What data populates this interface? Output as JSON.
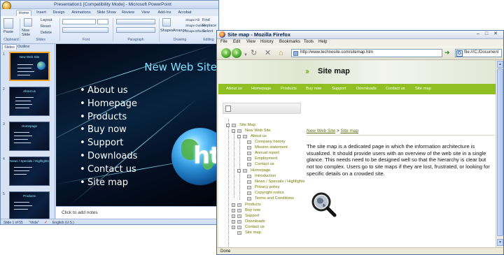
{
  "powerpoint": {
    "title": "Presentation1 [Compatibility Mode] - Microsoft PowerPoint",
    "tabs": [
      "Home",
      "Insert",
      "Design",
      "Animations",
      "Slide Show",
      "Review",
      "View",
      "Add-Ins",
      "Acrobat"
    ],
    "ribbon": {
      "paste": "Paste",
      "new_slide": "New Slide",
      "layout": "Layout",
      "reset": "Reset",
      "delete": "Delete",
      "shapes": "Shapes",
      "arrange": "Arrange",
      "quick_styles": "Quick Styles",
      "shape_fill": "Shape Fill",
      "shape_outline": "Shape Outline",
      "shape_effects": "Shape Effects",
      "find": "Find",
      "replace": "Replace",
      "select": "Select",
      "groups": [
        "Clipboard",
        "Slides",
        "Font",
        "Paragraph",
        "Drawing",
        "Editing"
      ]
    },
    "panel_tabs": [
      "Slides",
      "Outline"
    ],
    "thumbnails": [
      {
        "num": "1",
        "title": "New Web Site"
      },
      {
        "num": "2",
        "title": "About us"
      },
      {
        "num": "3",
        "title": "Homepage"
      },
      {
        "num": "4",
        "title": "News / Specials / Highlights"
      },
      {
        "num": "5",
        "title": "Products"
      }
    ],
    "slide": {
      "title": "New Web Site",
      "bullets": [
        "About us",
        "Homepage",
        "Products",
        "Buy now",
        "Support",
        "Downloads",
        "Contact us",
        "Site map"
      ],
      "globe_text": "ht"
    },
    "notes_placeholder": "Click to add notes",
    "status": {
      "slide": "Slide 1 of 55",
      "theme": "\"Vista\"",
      "language": "English (U.S.)"
    }
  },
  "firefox": {
    "title": "Site map - Mozilla Firefox",
    "menu": [
      "File",
      "Edit",
      "View",
      "History",
      "Bookmarks",
      "Tools",
      "Help"
    ],
    "url": "http://www.technosite.com/sitemap.htm",
    "search_value": "file:///C:/Document",
    "status": "Done",
    "site": {
      "page_title": "Site map",
      "nav": [
        "About us",
        "Homepage",
        "Products",
        "Buy now",
        "Support",
        "Downloads",
        "Contact us",
        "Site map"
      ],
      "tree": {
        "root": "Site Map",
        "site": "New Web Site",
        "about": "About us",
        "about_children": [
          "Company history",
          "Mission statement",
          "Annual report",
          "Employment",
          "Contact us"
        ],
        "homepage": "Homepage",
        "homepage_children": [
          "Introduction",
          "News / Specials / Highlights",
          "Privacy policy",
          "Copyright notice",
          "Terms and Conditions"
        ],
        "rest": [
          "Products",
          "Buy now",
          "Support",
          "Downloads",
          "Contact us",
          "Site map"
        ]
      },
      "breadcrumb": {
        "home": "New Web Site",
        "sep": ">",
        "current": "Site map"
      },
      "description": "The site map is a dedicated page in which the information architecture is visualized. It should provide users with an overview of the web site in a single glance. This needs need to be designed well so that the hierarchy is clear but not too complex. Users go to site maps if they are lost, frustrated, or looking for specific details on a crowded site."
    }
  },
  "colors": {
    "site_green": "#8fbf22",
    "tree_text": "#6e7a00",
    "slide_title": "#7fe0ff"
  }
}
